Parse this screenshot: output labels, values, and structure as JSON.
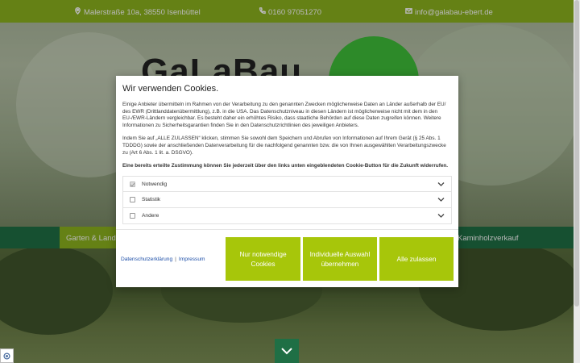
{
  "topbar": {
    "address": "Malerstraße 10a, 38550 Isenbüttel",
    "phone": "0160 97051270",
    "email": "info@galabau-ebert.de"
  },
  "hero": {
    "logo_text": "GaLaBau"
  },
  "nav": {
    "active_item": "Garten & Landschaftsbau",
    "right_item": "Kaminholzverkauf"
  },
  "modal": {
    "title": "Wir verwenden Cookies.",
    "paragraph1": "Einige Anbieter übermitteln im Rahmen von der Verarbeitung zu den genannten Zwecken möglicherweise Daten an Länder außerhalb der EU/ des EWR (Drittlanddatenübermittlung), z.B. in die USA. Das Datenschutzniveau in diesen Ländern ist möglicherweise nicht mit dem in den EU-/EWR-Ländern vergleichbar. Es besteht daher ein erhöhtes Risiko, dass staatliche Behörden auf diese Daten zugreifen können. Weitere Informationen zu Sicherheitsgarantien finden Sie in den Datenschutzrichtlinien des jeweiligen Anbieters.",
    "paragraph2": "Indem Sie auf „ALLE ZULASSEN“ klicken, stimmen Sie sowohl dem Speichern und Abrufen von Informationen auf Ihrem Gerät (§ 25 Abs. 1 TDDDG) sowie der anschließenden Datenverarbeitung für die nachfolgend genannten bzw. die von Ihnen ausgewählten Verarbeitungszwecke zu (Art 6 Abs. 1 lit. a. DSGVO).",
    "paragraph3": "Eine bereits erteilte Zustimmung können Sie jederzeit über den links unten eingeblendeten Cookie-Button für die Zukunft widerrufen.",
    "categories": [
      {
        "label": "Notwendig",
        "checked": true,
        "disabled": true
      },
      {
        "label": "Statistik",
        "checked": false,
        "disabled": false
      },
      {
        "label": "Andere",
        "checked": false,
        "disabled": false
      }
    ],
    "privacy_link": "Datenschutzerklärung",
    "link_separator": "|",
    "imprint_link": "Impressum",
    "btn_necessary": "Nur notwendige Cookies",
    "btn_individual": "Individuelle Auswahl übernehmen",
    "btn_all": "Alle zulassen"
  },
  "colors": {
    "brand_green": "#8cb31e",
    "button_green": "#a7c60a",
    "nav_dark_green": "#1f6f45",
    "link_blue": "#1e4fa8"
  }
}
